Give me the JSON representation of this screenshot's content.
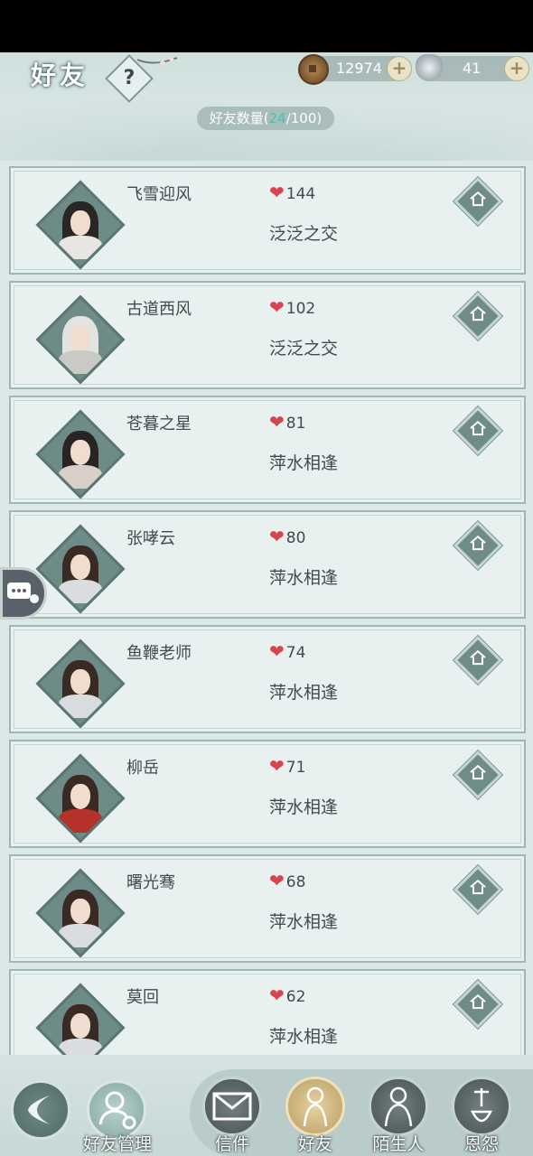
{
  "header": {
    "title": "好友",
    "help_label": "?",
    "copper": "12974",
    "silver": "41",
    "friend_count_label": "好友数量",
    "friend_count_current": "24",
    "friend_count_max": "/100)",
    "friend_count_open": "("
  },
  "friends": [
    {
      "name": "飞雪迎风",
      "likes": "144",
      "relation": "泛泛之交",
      "hair": "#2b2626",
      "robe": "#e8e6e2"
    },
    {
      "name": "古道西风",
      "likes": "102",
      "relation": "泛泛之交",
      "hair": "#e3e3e1",
      "robe": "#c9c9c6"
    },
    {
      "name": "苍暮之星",
      "likes": "81",
      "relation": "萍水相逢",
      "hair": "#2a2324",
      "robe": "#d8cfc8"
    },
    {
      "name": "张哮云",
      "likes": "80",
      "relation": "萍水相逢",
      "hair": "#3a2a24",
      "robe": "#d9dde0"
    },
    {
      "name": "鱼鞭老师",
      "likes": "74",
      "relation": "萍水相逢",
      "hair": "#3a2a24",
      "robe": "#d9dde0"
    },
    {
      "name": "柳岳",
      "likes": "71",
      "relation": "萍水相逢",
      "hair": "#3a2a24",
      "robe": "#b4322a"
    },
    {
      "name": "曙光骞",
      "likes": "68",
      "relation": "萍水相逢",
      "hair": "#3a2a24",
      "robe": "#d9dde0"
    },
    {
      "name": "莫回",
      "likes": "62",
      "relation": "萍水相逢",
      "hair": "#3a2a24",
      "robe": "#d9dde0"
    }
  ],
  "bottom": {
    "manage_label": "好友管理",
    "tabs": [
      "信件",
      "好友",
      "陌生人",
      "恩怨"
    ]
  },
  "colors": {
    "accent": "#3fc8b4",
    "heart": "#d9434d"
  }
}
